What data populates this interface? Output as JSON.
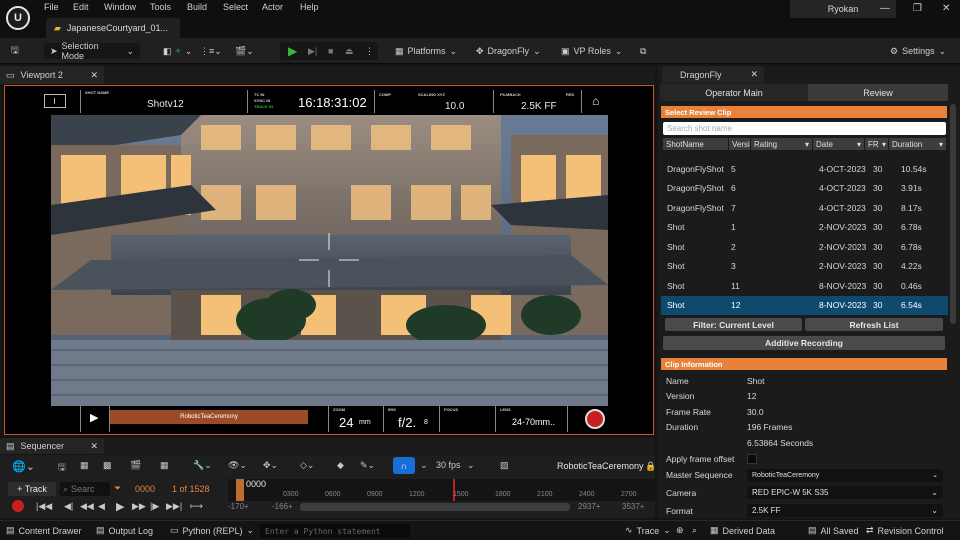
{
  "app": {
    "logo": "U",
    "menu": [
      "File",
      "Edit",
      "Window",
      "Tools",
      "Build",
      "Select",
      "Actor",
      "Help"
    ],
    "document_tab": "JapaneseCourtyard_01...",
    "project_name": "Ryokan",
    "window_buttons": [
      "—",
      "❐",
      "✕"
    ]
  },
  "toolbar": {
    "selection_mode": "Selection Mode",
    "platforms": "Platforms",
    "dragonfly": "DragonFly",
    "vp_roles": "VP Roles",
    "settings": "Settings"
  },
  "viewport": {
    "tab_label": "Viewport 2",
    "hud": {
      "shot_name_label": "SHOT NAME",
      "shot_name": "Shotv12",
      "tc_label": "TC IN",
      "sync_label": "SYNC IN",
      "track_label": "TRACK IN",
      "timecode": "16:18:31:02",
      "comp_label": "COMP",
      "scaling_label": "SCALING XYZ",
      "scaling": "10.0",
      "filmback_label": "FILMBACK",
      "filmback": "2.5K FF",
      "red_label": "RED",
      "take_name": "RoboticTeaCeremony",
      "zoom_label": "ZOOM",
      "zoom_value": "24",
      "zoom_unit": "mm",
      "iris_label": "IRIS",
      "iris_value": "f/2.",
      "iris_decimal": "8",
      "focus_label": "FOCUS",
      "lens_label": "LENS",
      "lens_value": "24-70mm.."
    }
  },
  "sequencer": {
    "tab_label": "Sequencer",
    "fps": "30 fps",
    "sequence_name": "RoboticTeaCeremony",
    "track_button": "+ Track",
    "search_placeholder": "Searc",
    "current_frame": "0000",
    "frame_counter": "1 of 1528",
    "playhead_label": "0000",
    "ruler": [
      "0300",
      "0600",
      "0900",
      "1200",
      "1500",
      "1800",
      "2100",
      "2400",
      "2700"
    ],
    "range_start": "-170+",
    "range_start2": "-166+",
    "range_end": "2937+",
    "range_end2": "3537+"
  },
  "statusbar": {
    "content_drawer": "Content Drawer",
    "output_log": "Output Log",
    "cmd": "Python (REPL)",
    "cmd_placeholder": "Enter a Python statement",
    "trace": "Trace",
    "derived_data": "Derived Data",
    "all_saved": "All Saved",
    "revision_control": "Revision Control"
  },
  "dragonfly_panel": {
    "tab_label": "DragonFly",
    "tabs": [
      "Operator Main",
      "Review"
    ],
    "select_review_clip": "Select Review Clip",
    "search_placeholder": "Search shot name",
    "columns": [
      "ShotName",
      "Versi",
      "Rating",
      "Date",
      "FR",
      "Duration"
    ],
    "rows": [
      {
        "shot": "DragonFlyShot",
        "version": "5",
        "date": "4-OCT-2023",
        "fr": "30",
        "duration": "10.54s"
      },
      {
        "shot": "DragonFlyShot",
        "version": "6",
        "date": "4-OCT-2023",
        "fr": "30",
        "duration": "3.91s"
      },
      {
        "shot": "DragonFlyShot",
        "version": "7",
        "date": "4-OCT-2023",
        "fr": "30",
        "duration": "8.17s"
      },
      {
        "shot": "Shot",
        "version": "1",
        "date": "2-NOV-2023",
        "fr": "30",
        "duration": "6.78s"
      },
      {
        "shot": "Shot",
        "version": "2",
        "date": "2-NOV-2023",
        "fr": "30",
        "duration": "6.78s"
      },
      {
        "shot": "Shot",
        "version": "3",
        "date": "2-NOV-2023",
        "fr": "30",
        "duration": "4.22s"
      },
      {
        "shot": "Shot",
        "version": "11",
        "date": "8-NOV-2023",
        "fr": "30",
        "duration": "0.46s"
      },
      {
        "shot": "Shot",
        "version": "12",
        "date": "8-NOV-2023",
        "fr": "30",
        "duration": "6.54s"
      }
    ],
    "filter_button": "Filter: Current Level",
    "refresh_button": "Refresh List",
    "additive_button": "Additive Recording",
    "clip_info_header": "Clip Information",
    "info": {
      "name_label": "Name",
      "name": "Shot",
      "version_label": "Version",
      "version": "12",
      "frame_rate_label": "Frame Rate",
      "frame_rate": "30.0",
      "duration_label": "Duration",
      "duration_frames": "196 Frames",
      "duration_seconds": "6.53864 Seconds",
      "apply_offset_label": "Apply frame offset",
      "master_seq_label": "Master Sequence",
      "master_seq": "RoboticTeaCeremony",
      "camera_label": "Camera",
      "camera": "RED EPIC-W 5K S35",
      "format_label": "Format",
      "format": "2.5K FF"
    }
  },
  "colors": {
    "accent_orange": "#e8823a",
    "selected_row": "#0e4a6e",
    "play_green": "#3cb43c",
    "record_red": "#c82020",
    "timeline_marker": "#e8823a"
  }
}
